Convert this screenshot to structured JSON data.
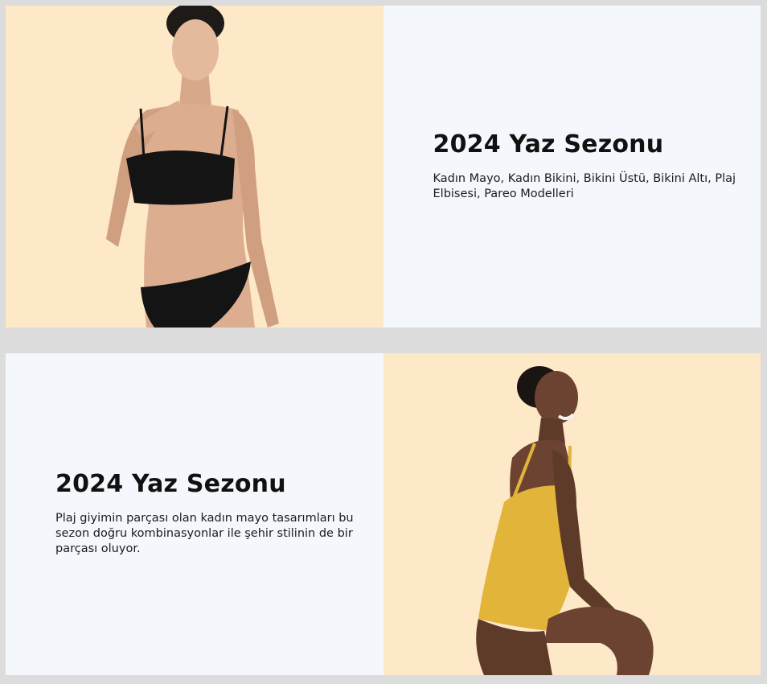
{
  "banners": [
    {
      "title": "2024 Yaz Sezonu",
      "description": "Kadın Mayo, Kadın Bikini, Bikini Üstü, Bikini Altı, Plaj Elbisesi, Pareo Modelleri",
      "image_icon": "model-black-bikini-photo",
      "image_side": "left"
    },
    {
      "title": "2024 Yaz Sezonu",
      "description": "Plaj giyimin parçası olan kadın mayo tasarımları bu sezon doğru kombinasyonlar ile şehir stilinin de bir parçası oluyor.",
      "image_icon": "model-yellow-swimsuit-photo",
      "image_side": "right"
    }
  ],
  "colors": {
    "page_bg": "#dcdcdc",
    "image_bg": "#fde8c8",
    "text_panel_bg": "#f4f7fb",
    "swimsuit_yellow": "#e8b83a",
    "bikini_black": "#141414"
  }
}
